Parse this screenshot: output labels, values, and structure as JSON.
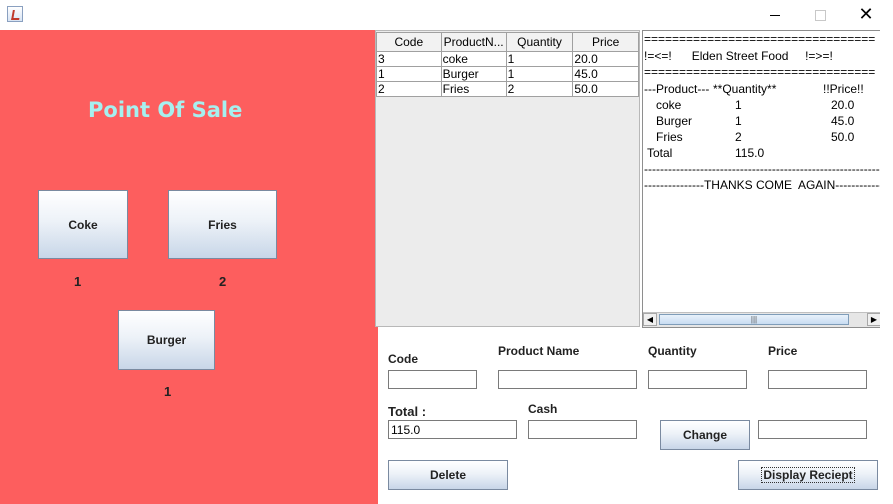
{
  "window": {
    "title": "",
    "icon": "java-app-icon",
    "controls": [
      "minimize-icon",
      "maximize-icon",
      "close-icon"
    ]
  },
  "left": {
    "title": "Point Of Sale",
    "products": [
      {
        "label": "Coke",
        "count": "1"
      },
      {
        "label": "Fries",
        "count": "2"
      },
      {
        "label": "Burger",
        "count": "1"
      }
    ]
  },
  "table": {
    "headers": [
      "Code",
      "ProductN...",
      "Quantity",
      "Price"
    ],
    "rows": [
      [
        "3",
        "coke",
        "1",
        "20.0"
      ],
      [
        "1",
        "Burger",
        "1",
        "45.0"
      ],
      [
        "2",
        "Fries",
        "2",
        "50.0"
      ]
    ]
  },
  "receipt": {
    "separator": "=================================",
    "shop_line": "!=<=!      Elden Street Food     !=>=!",
    "header_product": "---Product---",
    "header_quantity": "**Quantity**",
    "header_price": "!!Price!!",
    "items": [
      {
        "name": "coke",
        "qty": "1",
        "price": "20.0"
      },
      {
        "name": "Burger",
        "qty": "1",
        "price": "45.0"
      },
      {
        "name": "Fries",
        "qty": "2",
        "price": "50.0"
      }
    ],
    "total_label": "Total",
    "total_value": "115.0",
    "dash_line": "------------------------------------------------------------",
    "thanks_line": "---------------THANKS COME  AGAIN-------------"
  },
  "form": {
    "code_label": "Code",
    "product_name_label": "Product Name",
    "quantity_label": "Quantity",
    "price_label": "Price",
    "code_value": "",
    "product_name_value": "",
    "quantity_value": "",
    "price_value": "",
    "total_label": "Total :",
    "total_value": "115.0",
    "cash_label": "Cash",
    "cash_value": "",
    "change_label": "Change",
    "change_value": "",
    "delete_label": "Delete",
    "display_receipt_label": "Display Reciept"
  },
  "colors": {
    "left_panel": "#fd5e5e",
    "title_text": "#a6f0ef"
  }
}
